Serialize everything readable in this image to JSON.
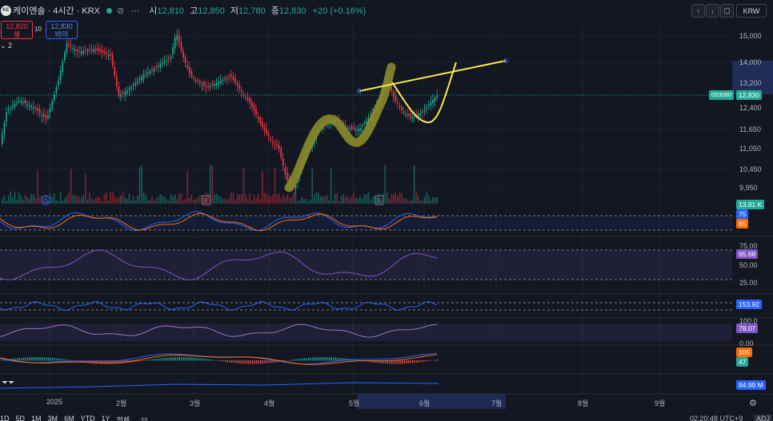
{
  "header": {
    "symbol": "케이엔솔 · 4시간 · KRX",
    "logo_text": "KE",
    "icons": [
      "eye-off-icon",
      "more-icon"
    ],
    "ohlc": {
      "o_label": "시",
      "o": "12,810",
      "h_label": "고",
      "h": "12,850",
      "l_label": "저",
      "l": "12,780",
      "c_label": "종",
      "c": "12,830",
      "change": "+20 (+0.16%)"
    },
    "right_buttons": [
      "↑",
      "↓",
      "▢"
    ],
    "currency": "KRW"
  },
  "trade": {
    "sell_price": "12,820",
    "sell_label": "셀",
    "spread": "10",
    "buy_price": "12,830",
    "buy_label": "바이"
  },
  "indicator_toggle": "2",
  "price_axis": [
    "15,000",
    "14,000",
    "13,200",
    "12,400",
    "11,650",
    "11,050",
    "10,450",
    "9,950"
  ],
  "price_tags": {
    "symbol_code": "053080",
    "last": "12,830"
  },
  "volume_tag": "13.81 K",
  "stoch_tags": [
    "75",
    "65"
  ],
  "rsi_axis": [
    "75.00",
    "50.00",
    "25.00"
  ],
  "rsi_tag": "65.68",
  "cci_tag": "153.92",
  "mfi_axis": [
    "100.0",
    "0.00"
  ],
  "mfi_tag": "78.07",
  "macd_tags": [
    "105",
    "47"
  ],
  "obv_tag": "84.99 M",
  "event_markers": [
    "D",
    "E",
    "E"
  ],
  "time_axis": [
    "2025",
    "2월",
    "3월",
    "4월",
    "5월",
    "6월",
    "7월",
    "8월",
    "9월"
  ],
  "bottom_bar": {
    "ranges": [
      "1D",
      "5D",
      "1M",
      "3M",
      "6M",
      "YTD",
      "1Y",
      "전체"
    ],
    "clock": "02:20:48 UTC+9",
    "adj": "ADJ"
  },
  "colors": {
    "up": "#22ab94",
    "down": "#f23645",
    "drawing_olive": "#8c8a2a",
    "drawing_yellow": "#f5e94b",
    "bg": "#131722"
  }
}
